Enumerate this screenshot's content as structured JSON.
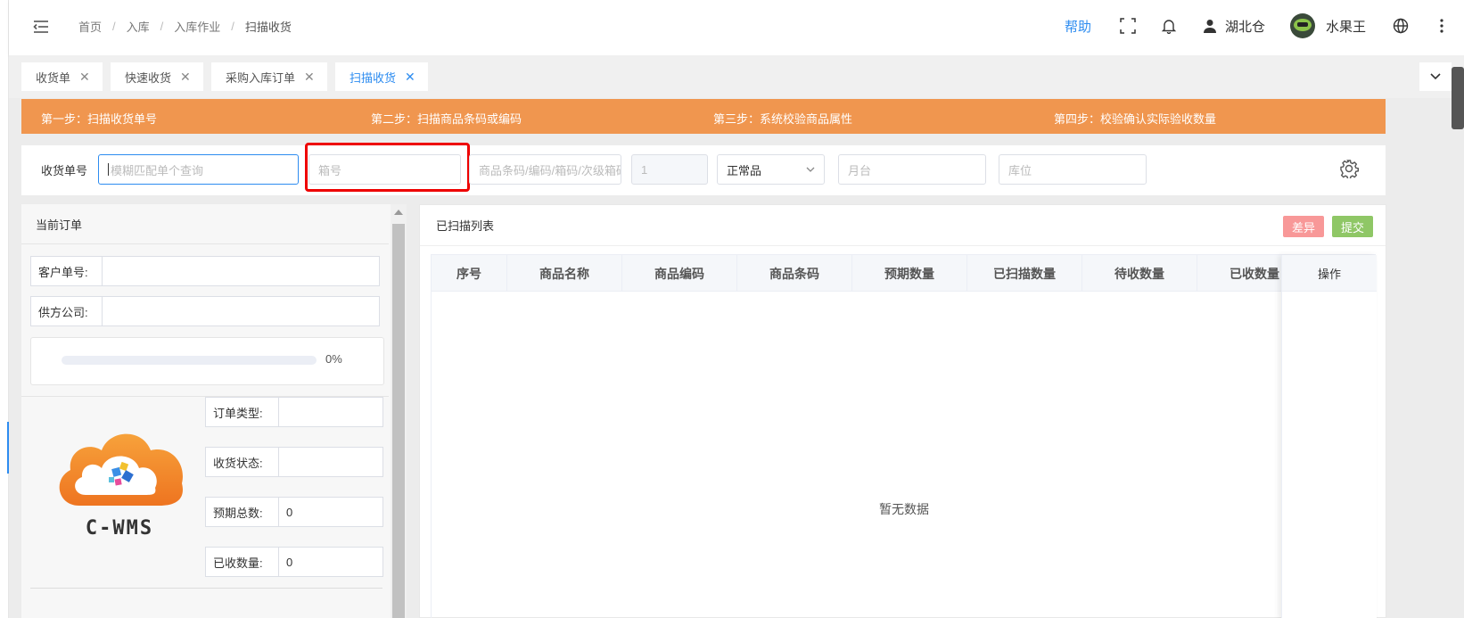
{
  "header": {
    "breadcrumb": [
      "首页",
      "入库",
      "入库作业",
      "扫描收货"
    ],
    "help": "帮助",
    "warehouse": "湖北仓",
    "username": "水果王"
  },
  "tabs": [
    {
      "label": "收货单",
      "active": false
    },
    {
      "label": "快速收货",
      "active": false
    },
    {
      "label": "采购入库订单",
      "active": false
    },
    {
      "label": "扫描收货",
      "active": true
    }
  ],
  "steps": [
    "第一步：扫描收货单号",
    "第二步：扫描商品条码或编码",
    "第三步：系统校验商品属性",
    "第四步：校验确认实际验收数量"
  ],
  "filters": {
    "order_label": "收货单号",
    "order_placeholder": "模糊匹配单个查询",
    "box_placeholder": "箱号",
    "barcode_placeholder": "商品条码/编码/箱码/次级箱码",
    "qty_value": "1",
    "quality_value": "正常品",
    "dock_placeholder": "月台",
    "location_placeholder": "库位"
  },
  "current_order": {
    "title": "当前订单",
    "customer_no_label": "客户单号:",
    "supplier_label": "供方公司:",
    "progress_percent": 0,
    "progress_text": "0%",
    "order_type_label": "订单类型:",
    "receive_status_label": "收货状态:",
    "expected_total_label": "预期总数:",
    "expected_total_value": "0",
    "received_qty_label": "已收数量:",
    "received_qty_value": "0",
    "logo_text": "C-WMS"
  },
  "scanned": {
    "title": "已扫描列表",
    "diff_button": "差异",
    "submit_button": "提交",
    "columns": [
      "序号",
      "商品名称",
      "商品编码",
      "商品条码",
      "预期数量",
      "已扫描数量",
      "待收数量",
      "已收数量"
    ],
    "action_column": "操作",
    "empty_text": "暂无数据"
  },
  "colors": {
    "accent": "#2d8cf0",
    "steps_bar": "#f0964f",
    "diff_button": "#f89898",
    "submit_button": "#8fc766",
    "highlight": "#ee0000"
  }
}
